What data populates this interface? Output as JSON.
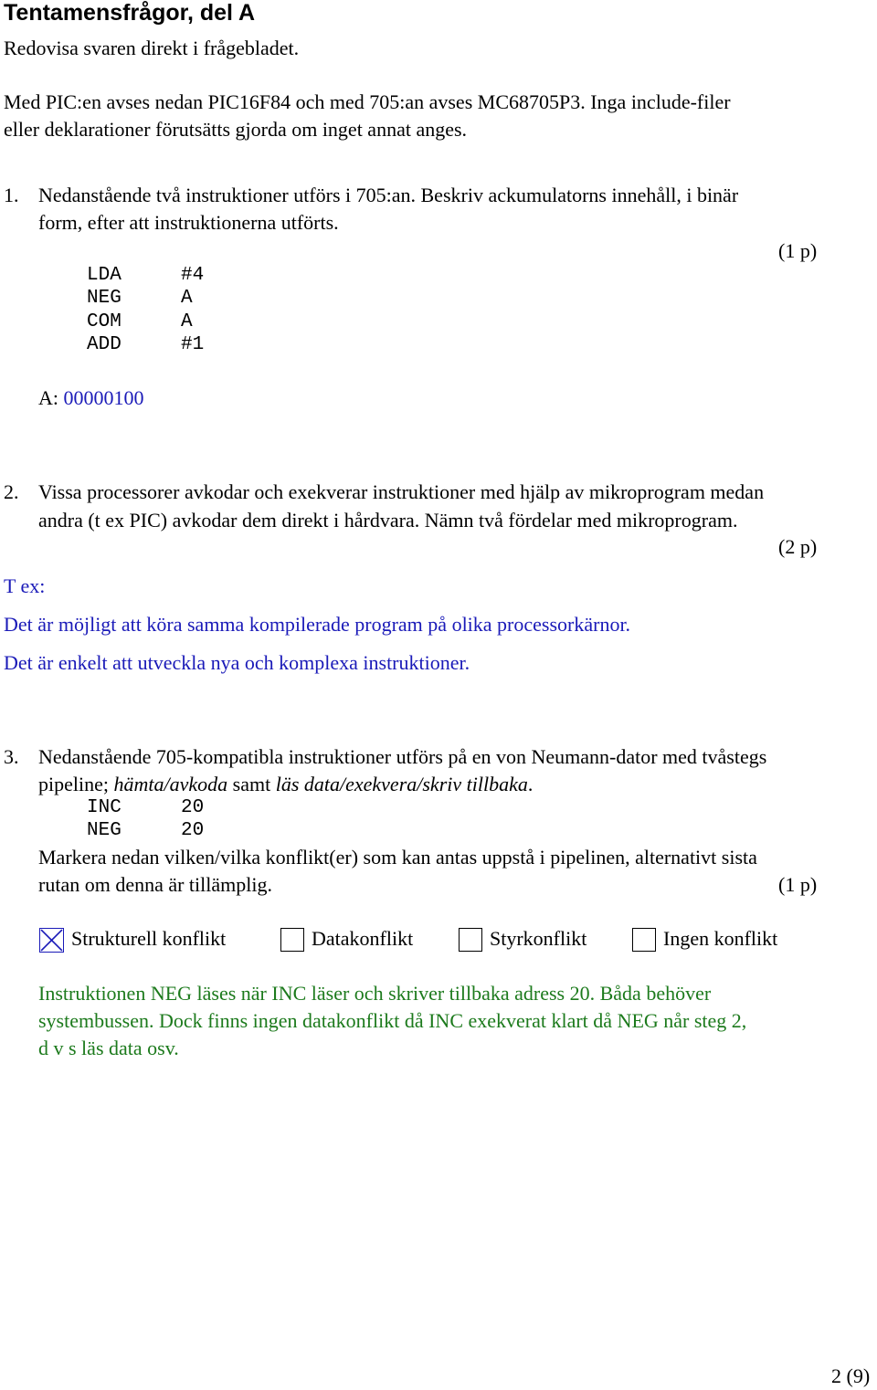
{
  "header": {
    "title": "Tentamensfrågor, del A",
    "subtitle": "Redovisa svaren direkt i frågebladet."
  },
  "intro": {
    "line1": "Med PIC:en avses nedan PIC16F84 och med 705:an avses MC68705P3. Inga include-filer",
    "line2": "eller deklarationer förutsätts gjorda om inget annat anges."
  },
  "q1": {
    "number": "1.",
    "line1": "Nedanstående två instruktioner utförs i 705:an. Beskriv ackumulatorns innehåll, i binär",
    "line2": "form, efter att instruktionerna utförts.",
    "points": "(1 p)",
    "code": [
      {
        "op": "LDA",
        "arg": "#4"
      },
      {
        "op": "NEG",
        "arg": "A"
      },
      {
        "op": "COM",
        "arg": "A"
      },
      {
        "op": "ADD",
        "arg": "#1"
      }
    ],
    "answer_label": "A:",
    "answer_value": "00000100"
  },
  "q2": {
    "number": "2.",
    "line1": "Vissa processorer avkodar och exekverar instruktioner med hjälp av mikroprogram medan",
    "line2": "andra (t ex PIC) avkodar dem direkt i hårdvara. Nämn två fördelar med mikroprogram.",
    "points": "(2 p)",
    "answer_intro": "T ex:",
    "answers": [
      "Det är möjligt att köra samma kompilerade program på olika processorkärnor.",
      "Det är enkelt att utveckla nya och komplexa instruktioner."
    ]
  },
  "q3": {
    "number": "3.",
    "line1": "Nedanstående 705-kompatibla instruktioner utförs på en von Neumann-dator med tvåstegs",
    "line2_pre": "pipeline; ",
    "line2_it1": "hämta/avkoda",
    "line2_mid": " samt ",
    "line2_it2": "läs data/exekvera/skriv tillbaka",
    "line2_post": ".",
    "code": [
      {
        "op": "INC",
        "arg": "20"
      },
      {
        "op": "NEG",
        "arg": "20"
      }
    ],
    "line3": "Markera nedan vilken/vilka konflikt(er) som kan antas uppstå i pipelinen, alternativt sista",
    "line4": "rutan om denna är tillämplig.",
    "points": "(1 p)",
    "options": [
      {
        "label": "Strukturell konflikt",
        "checked": true
      },
      {
        "label": "Datakonflikt",
        "checked": false
      },
      {
        "label": "Styrkonflikt",
        "checked": false
      },
      {
        "label": "Ingen konflikt",
        "checked": false
      }
    ],
    "answer_lines": [
      "Instruktionen NEG läses när INC läser och skriver tillbaka adress 20. Båda behöver",
      "systembussen. Dock finns ingen datakonflikt då INC exekverat klart då NEG når steg 2,",
      "d v s läs data osv."
    ]
  },
  "footer": {
    "page_number": "2 (9)"
  },
  "colors": {
    "answer_blue": "#1a1ab8",
    "answer_green": "#1c7a1c"
  }
}
